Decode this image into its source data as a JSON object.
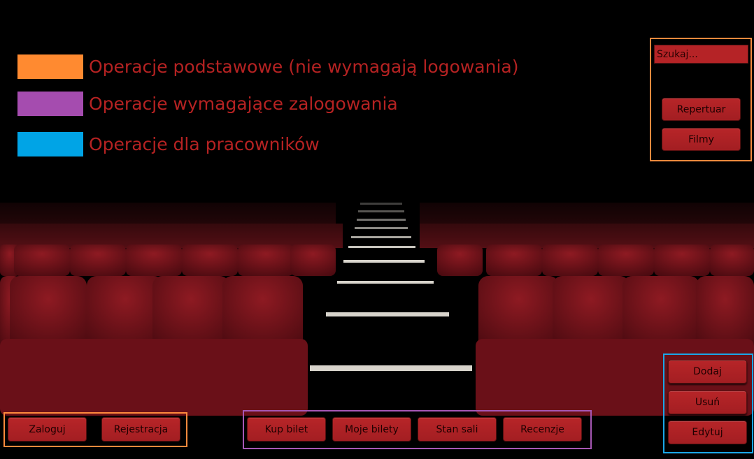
{
  "legend": [
    {
      "label": "Operacje podstawowe (nie wymagają logowania)",
      "color": "#ff8a30"
    },
    {
      "label": "Operacje wymagające zalogowania",
      "color": "#a54caf"
    },
    {
      "label": "Operacje dla pracowników",
      "color": "#00a4e6"
    }
  ],
  "search": {
    "placeholder": "Szukaj..."
  },
  "top_panel": {
    "repertuar_label": "Repertuar",
    "filmy_label": "Filmy"
  },
  "bottom_left": {
    "login_label": "Zaloguj",
    "register_label": "Rejestracja"
  },
  "bottom_center": {
    "buy_ticket_label": "Kup bilet",
    "my_tickets_label": "Moje bilety",
    "hall_status_label": "Stan sali",
    "reviews_label": "Recenzje"
  },
  "employee_panel": {
    "add_label": "Dodaj",
    "remove_label": "Usuń",
    "edit_label": "Edytuj"
  },
  "colors": {
    "button_red": "#b22326",
    "text_red": "#b52222",
    "orange": "#ff8a3d",
    "purple": "#a657b4",
    "blue": "#1aa7e8"
  }
}
